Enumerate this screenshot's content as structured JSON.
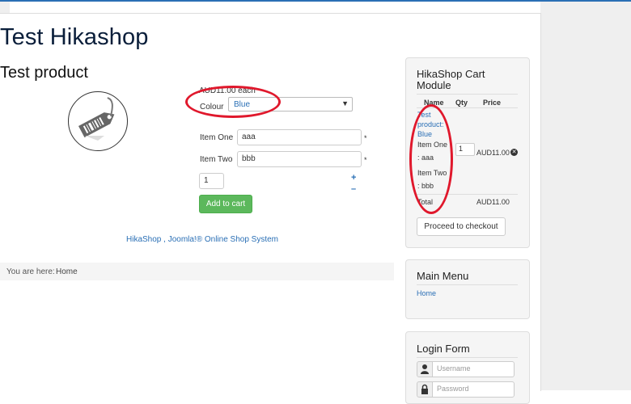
{
  "site": {
    "title": "Test Hikashop"
  },
  "product": {
    "title": "Test product",
    "price": "AUD11.00 each",
    "colour_label": "Colour",
    "colour_value": "Blue",
    "item_one_label": "Item One",
    "item_one_value": "aaa",
    "item_two_label": "Item Two",
    "item_two_value": "bbb",
    "required_mark": "*",
    "quantity": "1",
    "plus": "+",
    "minus": "–",
    "add_to_cart": "Add to cart",
    "footer_link": "HikaShop , Joomla!® Online Shop System"
  },
  "breadcrumb": {
    "label": "You are here:",
    "home": "Home"
  },
  "cart_module": {
    "title_line1": "HikaShop Cart",
    "title_line2": "Module",
    "col_name": "Name",
    "col_qty": "Qty",
    "col_price": "Price",
    "item_link_line1": "Test",
    "item_link_line2": "product:",
    "item_link_line3": "Blue",
    "item_detail_line1": "Item One",
    "item_detail_line2": ": aaa",
    "item_detail_line3": "Item Two",
    "item_detail_line4": ": bbb",
    "item_qty": "1",
    "item_price": "AUD11.00",
    "total_label": "Total",
    "total_value": "AUD11.00",
    "checkout_button": "Proceed to checkout"
  },
  "main_menu": {
    "title": "Main Menu",
    "home": "Home"
  },
  "login_form": {
    "title": "Login Form",
    "username_placeholder": "Username",
    "password_placeholder": "Password"
  },
  "colors": {
    "link": "#2a6fb5",
    "add_to_cart": "#5cb85c",
    "annotation": "#e0182c"
  }
}
